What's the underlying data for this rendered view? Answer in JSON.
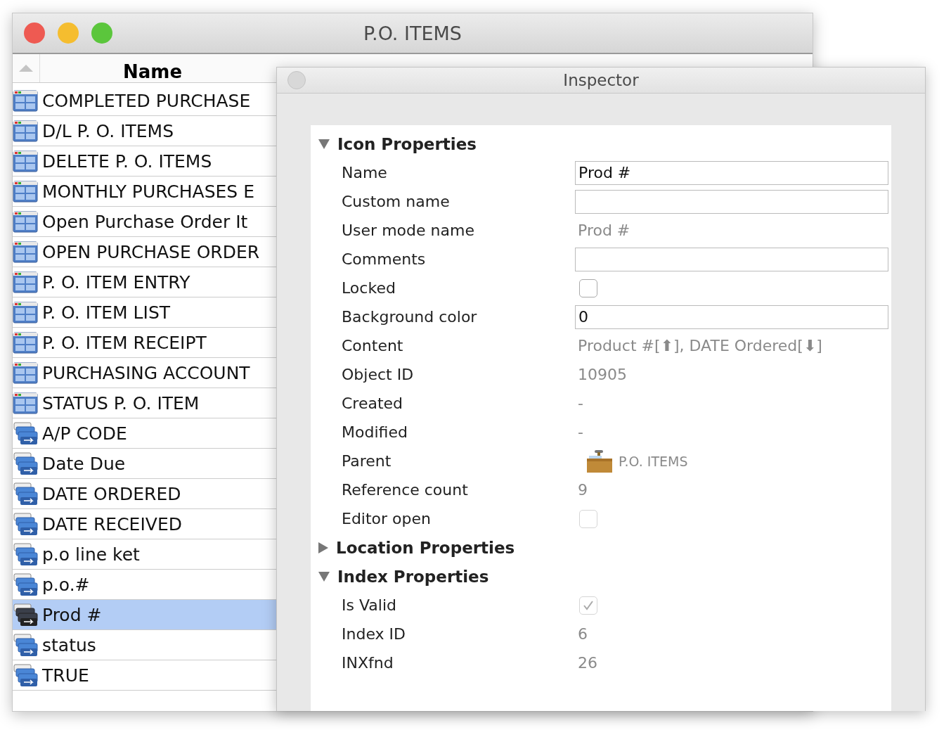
{
  "window": {
    "title": "P.O. ITEMS"
  },
  "list": {
    "header": "Name",
    "rows": [
      {
        "name": "COMPLETED PURCHASE",
        "kind": "form",
        "selected": false
      },
      {
        "name": "D/L P. O. ITEMS",
        "kind": "form",
        "selected": false
      },
      {
        "name": "DELETE P. O. ITEMS",
        "kind": "form",
        "selected": false
      },
      {
        "name": "MONTHLY PURCHASES E",
        "kind": "form",
        "selected": false
      },
      {
        "name": "Open Purchase Order It",
        "kind": "form",
        "selected": false
      },
      {
        "name": "OPEN PURCHASE ORDER",
        "kind": "form",
        "selected": false
      },
      {
        "name": "P. O. ITEM ENTRY",
        "kind": "form",
        "selected": false
      },
      {
        "name": "P. O. ITEM LIST",
        "kind": "form",
        "selected": false
      },
      {
        "name": "P. O. ITEM RECEIPT",
        "kind": "form",
        "selected": false
      },
      {
        "name": "PURCHASING ACCOUNT",
        "kind": "form",
        "selected": false
      },
      {
        "name": "STATUS P. O. ITEM",
        "kind": "form",
        "selected": false
      },
      {
        "name": "A/P CODE",
        "kind": "index",
        "selected": false
      },
      {
        "name": "Date Due",
        "kind": "index",
        "selected": false
      },
      {
        "name": "DATE ORDERED",
        "kind": "index",
        "selected": false
      },
      {
        "name": "DATE RECEIVED",
        "kind": "index",
        "selected": false
      },
      {
        "name": "p.o line ket",
        "kind": "index",
        "selected": false
      },
      {
        "name": "p.o.#",
        "kind": "index",
        "selected": false
      },
      {
        "name": "Prod #",
        "kind": "index",
        "selected": true
      },
      {
        "name": "status",
        "kind": "index",
        "selected": false
      },
      {
        "name": "TRUE",
        "kind": "index",
        "selected": false
      }
    ]
  },
  "inspector": {
    "title": "Inspector",
    "sections": [
      {
        "title": "Icon Properties",
        "expanded": true,
        "properties": [
          {
            "label": "Name",
            "kind": "field",
            "value": "Prod #"
          },
          {
            "label": "Custom name",
            "kind": "field"
          },
          {
            "label": "User mode name",
            "kind": "text",
            "value": "Prod #"
          },
          {
            "label": "Comments",
            "kind": "field"
          },
          {
            "label": "Locked",
            "kind": "checkbox",
            "checked": false,
            "disabled": false
          },
          {
            "label": "Background color",
            "kind": "field",
            "value": "0"
          },
          {
            "label": "Content",
            "kind": "text",
            "value": "Product #[⬆], DATE Ordered[⬇]"
          },
          {
            "label": "Object ID",
            "kind": "text",
            "value": "10905"
          },
          {
            "label": "Created",
            "kind": "text",
            "value": "-"
          },
          {
            "label": "Modified",
            "kind": "text",
            "value": "-"
          },
          {
            "label": "Parent",
            "kind": "parent",
            "value": "P.O. ITEMS"
          },
          {
            "label": "Reference count",
            "kind": "text",
            "value": "9"
          },
          {
            "label": "Editor open",
            "kind": "checkbox",
            "checked": false,
            "disabled": true
          }
        ]
      },
      {
        "title": "Location Properties",
        "expanded": false
      },
      {
        "title": "Index Properties",
        "expanded": true,
        "properties": [
          {
            "label": "Is Valid",
            "kind": "checkbox",
            "checked": true,
            "disabled": true
          },
          {
            "label": "Index ID",
            "kind": "text",
            "value": "6"
          },
          {
            "label": "INXfnd",
            "kind": "text",
            "value": "26"
          }
        ]
      }
    ]
  }
}
